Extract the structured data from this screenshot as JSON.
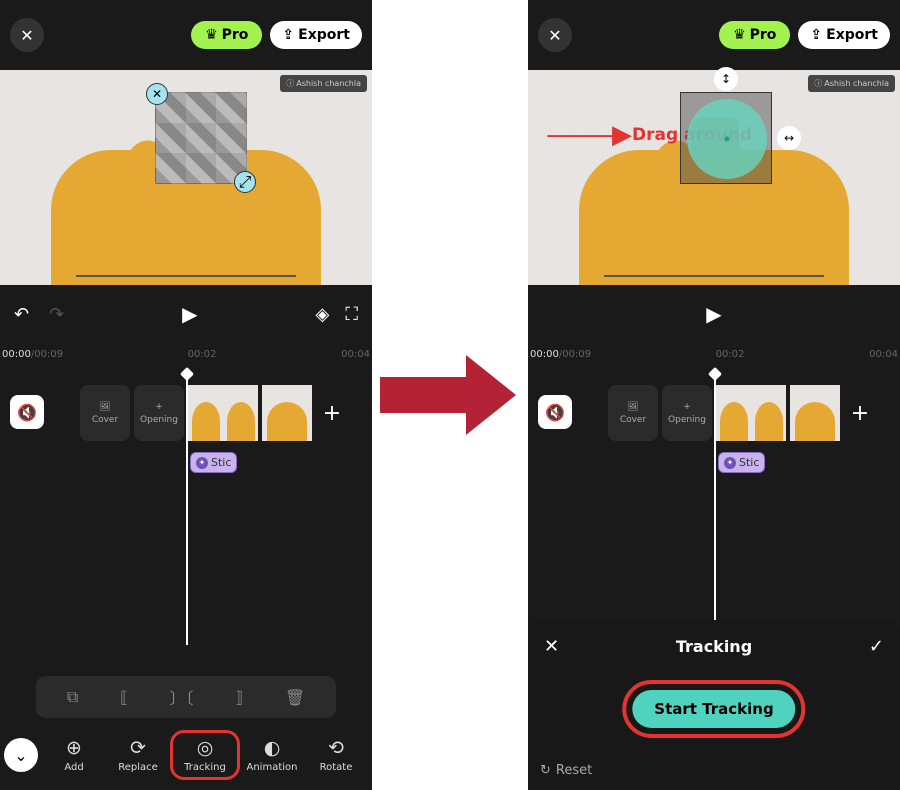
{
  "topbar": {
    "pro": "Pro",
    "export": "Export"
  },
  "viewport": {
    "tag": "Ashish chanchla",
    "drag_annotation": "Drag around"
  },
  "timecodes": {
    "current": "00:00",
    "duration": "00:09",
    "t1": "00:02",
    "t2": "00:04",
    "t3": "00:02",
    "t4": "00:04"
  },
  "timeline": {
    "cover": "Cover",
    "opening": "Opening",
    "plus": "+",
    "sticker": "Stic"
  },
  "bottom": {
    "add": "Add",
    "replace": "Replace",
    "tracking": "Tracking",
    "animation": "Animation",
    "rotate": "Rotate"
  },
  "panel": {
    "title": "Tracking",
    "start": "Start Tracking",
    "reset": "Reset"
  }
}
